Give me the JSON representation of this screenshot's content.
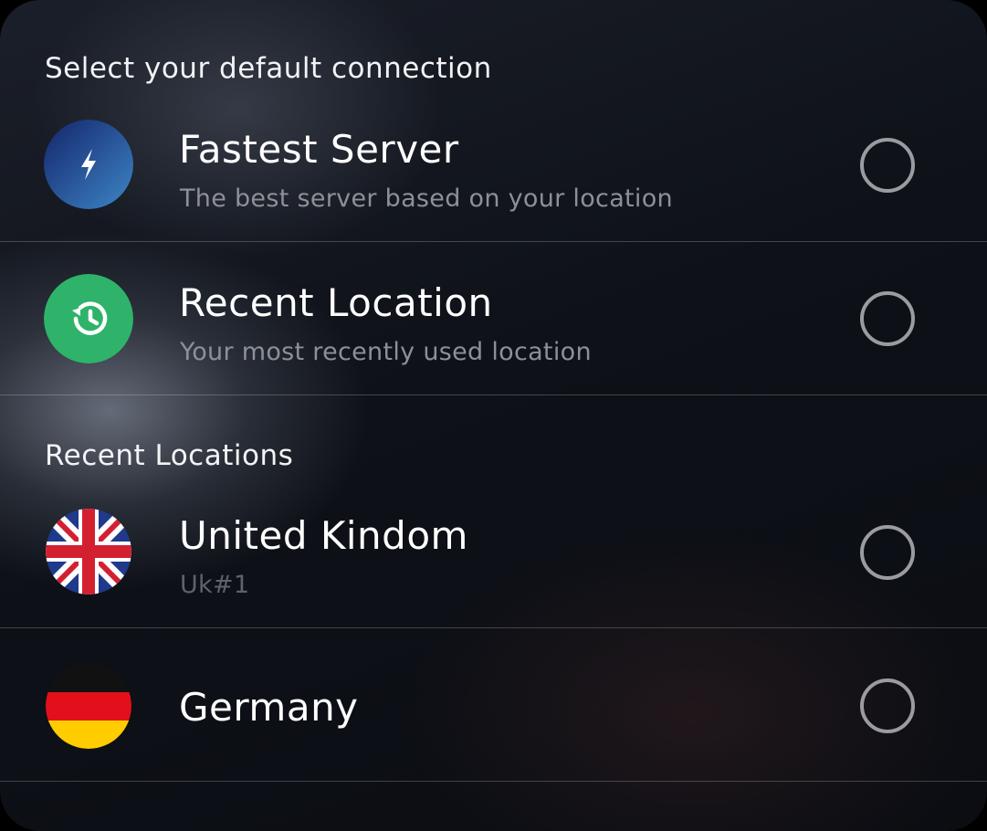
{
  "header": {
    "title": "Select your default connection"
  },
  "options": [
    {
      "title": "Fastest Server",
      "subtitle": "The best server based on your location",
      "icon": "lightning-icon",
      "selected": false
    },
    {
      "title": "Recent Location",
      "subtitle": "Your most recently used location",
      "icon": "history-icon",
      "selected": false
    }
  ],
  "recent": {
    "heading": "Recent Locations",
    "items": [
      {
        "title": "United Kindom",
        "subtitle": "Uk#1",
        "icon": "uk-flag-icon",
        "selected": false
      },
      {
        "title": "Germany",
        "subtitle": "",
        "icon": "germany-flag-icon",
        "selected": false
      }
    ]
  },
  "colors": {
    "fastest_icon": "#2b63a8",
    "recent_icon": "#2fb36a",
    "radio_border": "#9a9ca1",
    "divider": "#3a3d44"
  }
}
